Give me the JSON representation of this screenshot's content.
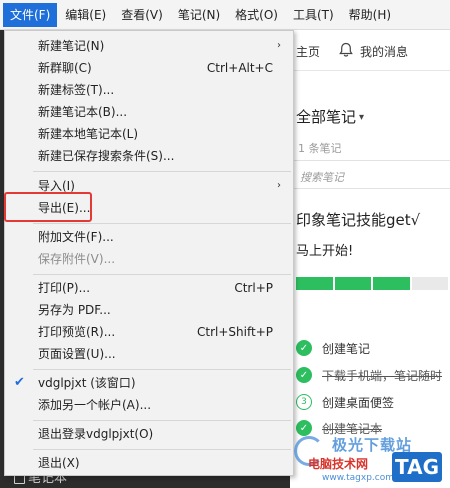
{
  "menubar": {
    "items": [
      "文件(F)",
      "编辑(E)",
      "查看(V)",
      "笔记(N)",
      "格式(O)",
      "工具(T)",
      "帮助(H)"
    ]
  },
  "file_menu": {
    "items": [
      {
        "label": "新建笔记(N)",
        "shortcut": "",
        "submenu": true
      },
      {
        "label": "新群聊(C)",
        "shortcut": "Ctrl+Alt+C"
      },
      {
        "label": "新建标签(T)..."
      },
      {
        "label": "新建笔记本(B)..."
      },
      {
        "label": "新建本地笔记本(L)"
      },
      {
        "label": "新建已保存搜索条件(S)..."
      },
      {
        "label": "导入(I)",
        "submenu": true
      },
      {
        "label": "导出(E)..."
      },
      {
        "label": "附加文件(F)..."
      },
      {
        "label": "保存附件(V)...",
        "disabled": true
      },
      {
        "label": "打印(P)...",
        "shortcut": "Ctrl+P"
      },
      {
        "label": "另存为 PDF..."
      },
      {
        "label": "打印预览(R)...",
        "shortcut": "Ctrl+Shift+P"
      },
      {
        "label": "页面设置(U)..."
      },
      {
        "label": "vdglpjxt (该窗口)",
        "checked": true
      },
      {
        "label": "添加另一个帐户(A)..."
      },
      {
        "label": "退出登录vdglpjxt(O)"
      },
      {
        "label": "退出(X)"
      }
    ],
    "arrow_glyph": "›",
    "check_glyph": "✔"
  },
  "topbar": {
    "home_label": "主页",
    "messages_label": "我的消息"
  },
  "notes_panel": {
    "title": "全部笔记",
    "caret": "▾",
    "count": "1 条笔记",
    "search_placeholder": "搜索笔记"
  },
  "note": {
    "title": "印象笔记技能get√",
    "subtitle": "马上开始!",
    "progress_completed": 3,
    "progress_total": 4,
    "tasks": [
      {
        "text": "创建笔记",
        "done": true
      },
      {
        "text": "下载手机端，笔记随时",
        "done": true,
        "struck": true
      },
      {
        "text": "创建桌面便签",
        "done": false,
        "number": "3"
      },
      {
        "text": "创建笔记本",
        "done": true,
        "struck": true
      }
    ]
  },
  "sidebar_peek": {
    "label": "笔记本"
  },
  "watermark": {
    "line1": "极光下载站",
    "line2": "电脑技术网",
    "line3": "www.tagxp.com",
    "tag": "TAG"
  },
  "colors": {
    "accent": "#1e6fd9",
    "green": "#2dbe60",
    "highlight": "#e53935"
  }
}
